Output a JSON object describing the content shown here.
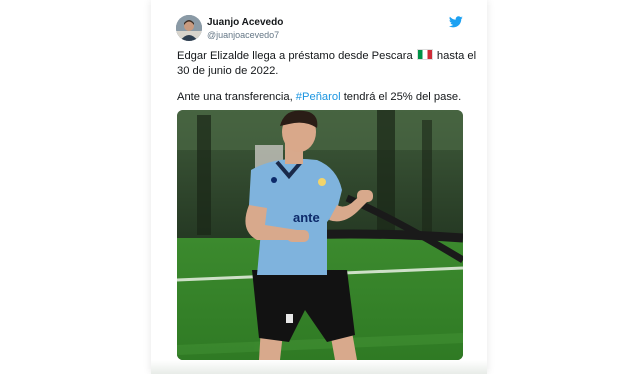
{
  "tweet": {
    "author": {
      "display_name": "Juanjo Acevedo",
      "handle": "@juanjoacevedo7"
    },
    "platform_icon": "twitter-bird-icon",
    "text": {
      "line1_before_flag": "Edgar Elizalde llega a préstamo desde Pescara",
      "flag_emoji": "italy-flag",
      "line1_after_flag": "hasta el",
      "line2": "30 de junio de 2022.",
      "line3_before_hashtag": "Ante una transferencia,",
      "hashtag": "#Peñarol",
      "line3_after_hashtag": "tendrá el 25% del pase."
    },
    "image": {
      "shirt_sponsor": "ante"
    }
  },
  "colors": {
    "twitter_blue": "#1da1f2",
    "hashtag": "#1b95e0",
    "text_primary": "#14171a",
    "text_secondary": "#657786"
  }
}
